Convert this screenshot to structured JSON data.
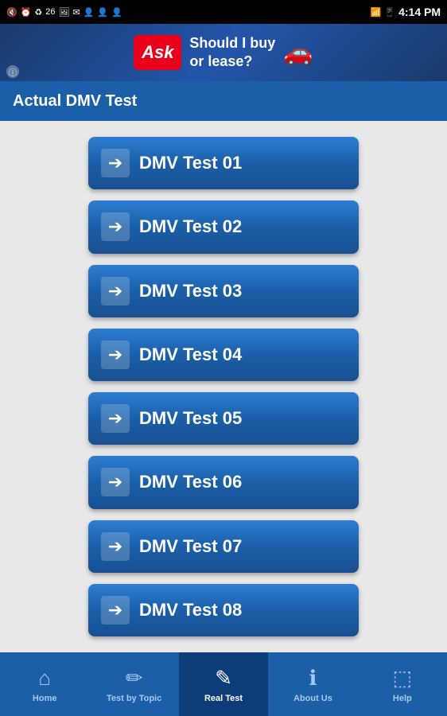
{
  "status_bar": {
    "left_icons": "🔇 ⏰ ♻ 26 🖼 ✉ 👤 👤 👤",
    "time": "4:14 PM",
    "battery_icon": "🔋"
  },
  "ad": {
    "logo_text": "Ask",
    "line1": "Should I buy",
    "line2": "or lease?",
    "info": "ⓘ"
  },
  "header": {
    "title": "Actual DMV Test"
  },
  "tests": [
    {
      "id": 1,
      "label": "DMV Test 01"
    },
    {
      "id": 2,
      "label": "DMV Test 02"
    },
    {
      "id": 3,
      "label": "DMV Test 03"
    },
    {
      "id": 4,
      "label": "DMV Test 04"
    },
    {
      "id": 5,
      "label": "DMV Test 05"
    },
    {
      "id": 6,
      "label": "DMV Test 06"
    },
    {
      "id": 7,
      "label": "DMV Test 07"
    },
    {
      "id": 8,
      "label": "DMV Test 08"
    }
  ],
  "nav": {
    "items": [
      {
        "id": "home",
        "label": "Home",
        "icon": "⌂",
        "active": false
      },
      {
        "id": "test-by-topic",
        "label": "Test by Topic",
        "icon": "✏",
        "active": false
      },
      {
        "id": "real-test",
        "label": "Real Test",
        "icon": "✎",
        "active": true
      },
      {
        "id": "about-us",
        "label": "About Us",
        "icon": "ℹ",
        "active": false
      },
      {
        "id": "help",
        "label": "Help",
        "icon": "⬚",
        "active": false
      }
    ]
  },
  "arrow_symbol": "➔"
}
